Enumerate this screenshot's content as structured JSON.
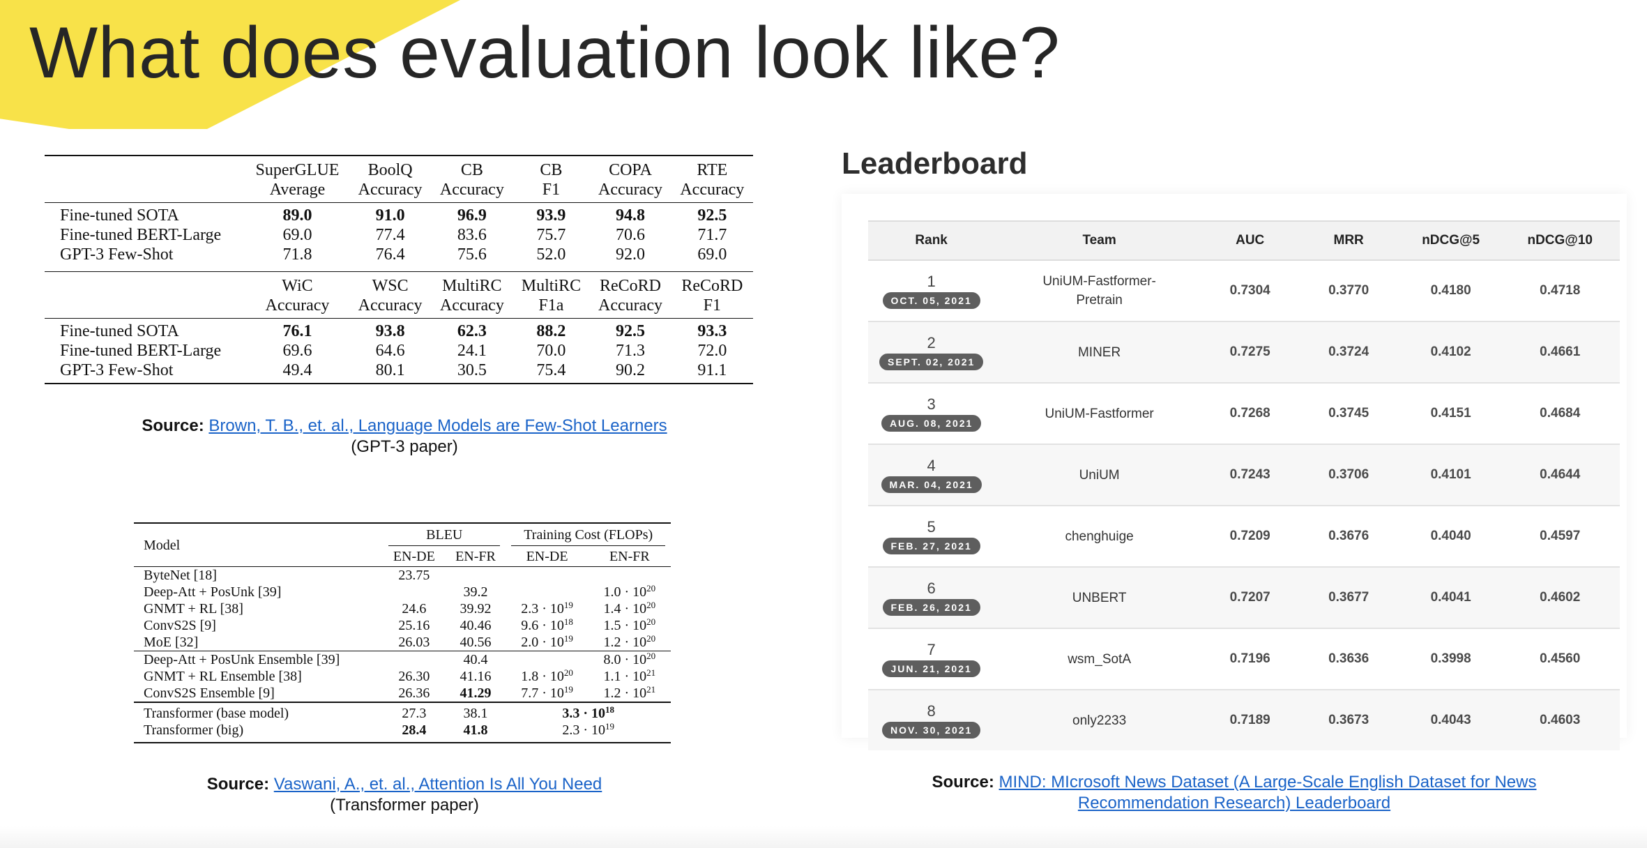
{
  "title": "What does evaluation look like?",
  "superglue": {
    "top_headers": [
      [
        "SuperGLUE",
        "Average"
      ],
      [
        "BoolQ",
        "Accuracy"
      ],
      [
        "CB",
        "Accuracy"
      ],
      [
        "CB",
        "F1"
      ],
      [
        "COPA",
        "Accuracy"
      ],
      [
        "RTE",
        "Accuracy"
      ]
    ],
    "top_rows": [
      {
        "name": "Fine-tuned SOTA",
        "vals": [
          "89.0",
          "91.0",
          "96.9",
          "93.9",
          "94.8",
          "92.5"
        ]
      },
      {
        "name": "Fine-tuned BERT-Large",
        "vals": [
          "69.0",
          "77.4",
          "83.6",
          "75.7",
          "70.6",
          "71.7"
        ]
      },
      {
        "name": "GPT-3 Few-Shot",
        "vals": [
          "71.8",
          "76.4",
          "75.6",
          "52.0",
          "92.0",
          "69.0"
        ]
      }
    ],
    "bottom_headers": [
      [
        "WiC",
        "Accuracy"
      ],
      [
        "WSC",
        "Accuracy"
      ],
      [
        "MultiRC",
        "Accuracy"
      ],
      [
        "MultiRC",
        "F1a"
      ],
      [
        "ReCoRD",
        "Accuracy"
      ],
      [
        "ReCoRD",
        "F1"
      ]
    ],
    "bottom_rows": [
      {
        "name": "Fine-tuned SOTA",
        "vals": [
          "76.1",
          "93.8",
          "62.3",
          "88.2",
          "92.5",
          "93.3"
        ]
      },
      {
        "name": "Fine-tuned BERT-Large",
        "vals": [
          "69.6",
          "64.6",
          "24.1",
          "70.0",
          "71.3",
          "72.0"
        ]
      },
      {
        "name": "GPT-3 Few-Shot",
        "vals": [
          "49.4",
          "80.1",
          "30.5",
          "75.4",
          "90.2",
          "91.1"
        ]
      }
    ],
    "source_label": "Source:",
    "source_link": "Brown, T. B., et. al., Language Models are Few-Shot Learners",
    "source_note": "(GPT-3 paper)"
  },
  "transformer": {
    "col_model": "Model",
    "col_bleu": "BLEU",
    "col_cost": "Training Cost (FLOPs)",
    "sub_en_de": "EN-DE",
    "sub_en_fr": "EN-FR",
    "rows": [
      {
        "model": "ByteNet [18]",
        "bleu_de": "23.75",
        "bleu_fr": "",
        "cost_de": "",
        "cost_fr": ""
      },
      {
        "model": "Deep-Att + PosUnk [39]",
        "bleu_de": "",
        "bleu_fr": "39.2",
        "cost_de": "",
        "cost_fr": "1.0 · 10",
        "cost_fr_exp": "20"
      },
      {
        "model": "GNMT + RL [38]",
        "bleu_de": "24.6",
        "bleu_fr": "39.92",
        "cost_de": "2.3 · 10",
        "cost_de_exp": "19",
        "cost_fr": "1.4 · 10",
        "cost_fr_exp": "20"
      },
      {
        "model": "ConvS2S [9]",
        "bleu_de": "25.16",
        "bleu_fr": "40.46",
        "cost_de": "9.6 · 10",
        "cost_de_exp": "18",
        "cost_fr": "1.5 · 10",
        "cost_fr_exp": "20"
      },
      {
        "model": "MoE [32]",
        "bleu_de": "26.03",
        "bleu_fr": "40.56",
        "cost_de": "2.0 · 10",
        "cost_de_exp": "19",
        "cost_fr": "1.2 · 10",
        "cost_fr_exp": "20"
      },
      {
        "model": "Deep-Att + PosUnk Ensemble [39]",
        "bleu_de": "",
        "bleu_fr": "40.4",
        "cost_de": "",
        "cost_fr": "8.0 · 10",
        "cost_fr_exp": "20"
      },
      {
        "model": "GNMT + RL Ensemble [38]",
        "bleu_de": "26.30",
        "bleu_fr": "41.16",
        "cost_de": "1.8 · 10",
        "cost_de_exp": "20",
        "cost_fr": "1.1 · 10",
        "cost_fr_exp": "21"
      },
      {
        "model": "ConvS2S Ensemble [9]",
        "bleu_de": "26.36",
        "bleu_fr": "41.29",
        "cost_de": "7.7 · 10",
        "cost_de_exp": "19",
        "cost_fr": "1.2 · 10",
        "cost_fr_exp": "21"
      },
      {
        "model": "Transformer (base model)",
        "bleu_de": "27.3",
        "bleu_fr": "38.1",
        "cost_merged": "3.3 · 10",
        "cost_merged_exp": "18"
      },
      {
        "model": "Transformer (big)",
        "bleu_de": "28.4",
        "bleu_fr": "41.8",
        "cost_merged": "2.3 · 10",
        "cost_merged_exp": "19"
      }
    ],
    "source_label": "Source:",
    "source_link": "Vaswani, A., et. al., Attention Is All You Need",
    "source_note": "(Transformer paper)"
  },
  "leaderboard": {
    "title": "Leaderboard",
    "headers": [
      "Rank",
      "Team",
      "AUC",
      "MRR",
      "nDCG@5",
      "nDCG@10"
    ],
    "rows": [
      {
        "rank": "1",
        "date": "OCT. 05, 2021",
        "team_line1": "UniUM-Fastformer-",
        "team_line2": "Pretrain",
        "auc": "0.7304",
        "mrr": "0.3770",
        "ndcg5": "0.4180",
        "ndcg10": "0.4718"
      },
      {
        "rank": "2",
        "date": "SEPT. 02, 2021",
        "team_line1": "MINER",
        "team_line2": "",
        "auc": "0.7275",
        "mrr": "0.3724",
        "ndcg5": "0.4102",
        "ndcg10": "0.4661"
      },
      {
        "rank": "3",
        "date": "AUG. 08, 2021",
        "team_line1": "UniUM-Fastformer",
        "team_line2": "",
        "auc": "0.7268",
        "mrr": "0.3745",
        "ndcg5": "0.4151",
        "ndcg10": "0.4684"
      },
      {
        "rank": "4",
        "date": "MAR. 04, 2021",
        "team_line1": "UniUM",
        "team_line2": "",
        "auc": "0.7243",
        "mrr": "0.3706",
        "ndcg5": "0.4101",
        "ndcg10": "0.4644"
      },
      {
        "rank": "5",
        "date": "FEB. 27, 2021",
        "team_line1": "chenghuige",
        "team_line2": "",
        "auc": "0.7209",
        "mrr": "0.3676",
        "ndcg5": "0.4040",
        "ndcg10": "0.4597"
      },
      {
        "rank": "6",
        "date": "FEB. 26, 2021",
        "team_line1": "UNBERT",
        "team_line2": "",
        "auc": "0.7207",
        "mrr": "0.3677",
        "ndcg5": "0.4041",
        "ndcg10": "0.4602"
      },
      {
        "rank": "7",
        "date": "JUN. 21, 2021",
        "team_line1": "wsm_SotA",
        "team_line2": "",
        "auc": "0.7196",
        "mrr": "0.3636",
        "ndcg5": "0.3998",
        "ndcg10": "0.4560"
      },
      {
        "rank": "8",
        "date": "NOV. 30, 2021",
        "team_line1": "only2233",
        "team_line2": "",
        "auc": "0.7189",
        "mrr": "0.3673",
        "ndcg5": "0.4043",
        "ndcg10": "0.4603"
      }
    ],
    "source_label": "Source:",
    "source_link_line1": "MIND: MIcrosoft News Dataset (A Large-Scale English Dataset for News",
    "source_link_line2": "Recommendation Research) Leaderboard"
  }
}
